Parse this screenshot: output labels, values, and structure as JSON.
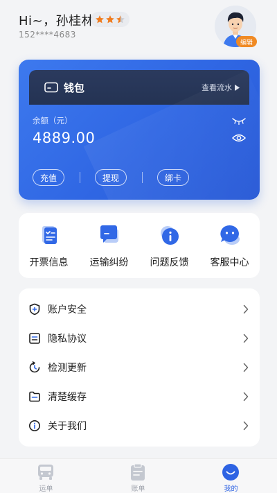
{
  "header": {
    "greeting": "Hi~，孙桂林",
    "phone": "152****4683",
    "rating": 2.5,
    "edit_label": "编辑"
  },
  "wallet": {
    "title": "钱包",
    "flow_link": "查看流水",
    "balance_label": "余额（元）",
    "balance_value": "4889.00",
    "buttons": [
      "充值",
      "提现",
      "绑卡"
    ]
  },
  "quick_actions": [
    {
      "label": "开票信息",
      "icon": "invoice-icon"
    },
    {
      "label": "运输纠纷",
      "icon": "dispute-chat-icon"
    },
    {
      "label": "问题反馈",
      "icon": "info-feedback-icon"
    },
    {
      "label": "客服中心",
      "icon": "customer-service-icon"
    }
  ],
  "menu": [
    {
      "label": "账户安全",
      "icon": "shield-icon"
    },
    {
      "label": "隐私协议",
      "icon": "document-icon"
    },
    {
      "label": "检测更新",
      "icon": "refresh-icon"
    },
    {
      "label": "清楚缓存",
      "icon": "folder-icon"
    },
    {
      "label": "关于我们",
      "icon": "info-icon"
    }
  ],
  "tabs": [
    {
      "label": "运单",
      "icon": "truck-icon",
      "active": false
    },
    {
      "label": "账单",
      "icon": "clipboard-icon",
      "active": false
    },
    {
      "label": "我的",
      "icon": "smile-icon",
      "active": true
    }
  ],
  "colors": {
    "accent": "#2e63e3",
    "wallet_header": "#27365a",
    "star": "#f07c1e",
    "edit_badge": "#f08a24"
  }
}
